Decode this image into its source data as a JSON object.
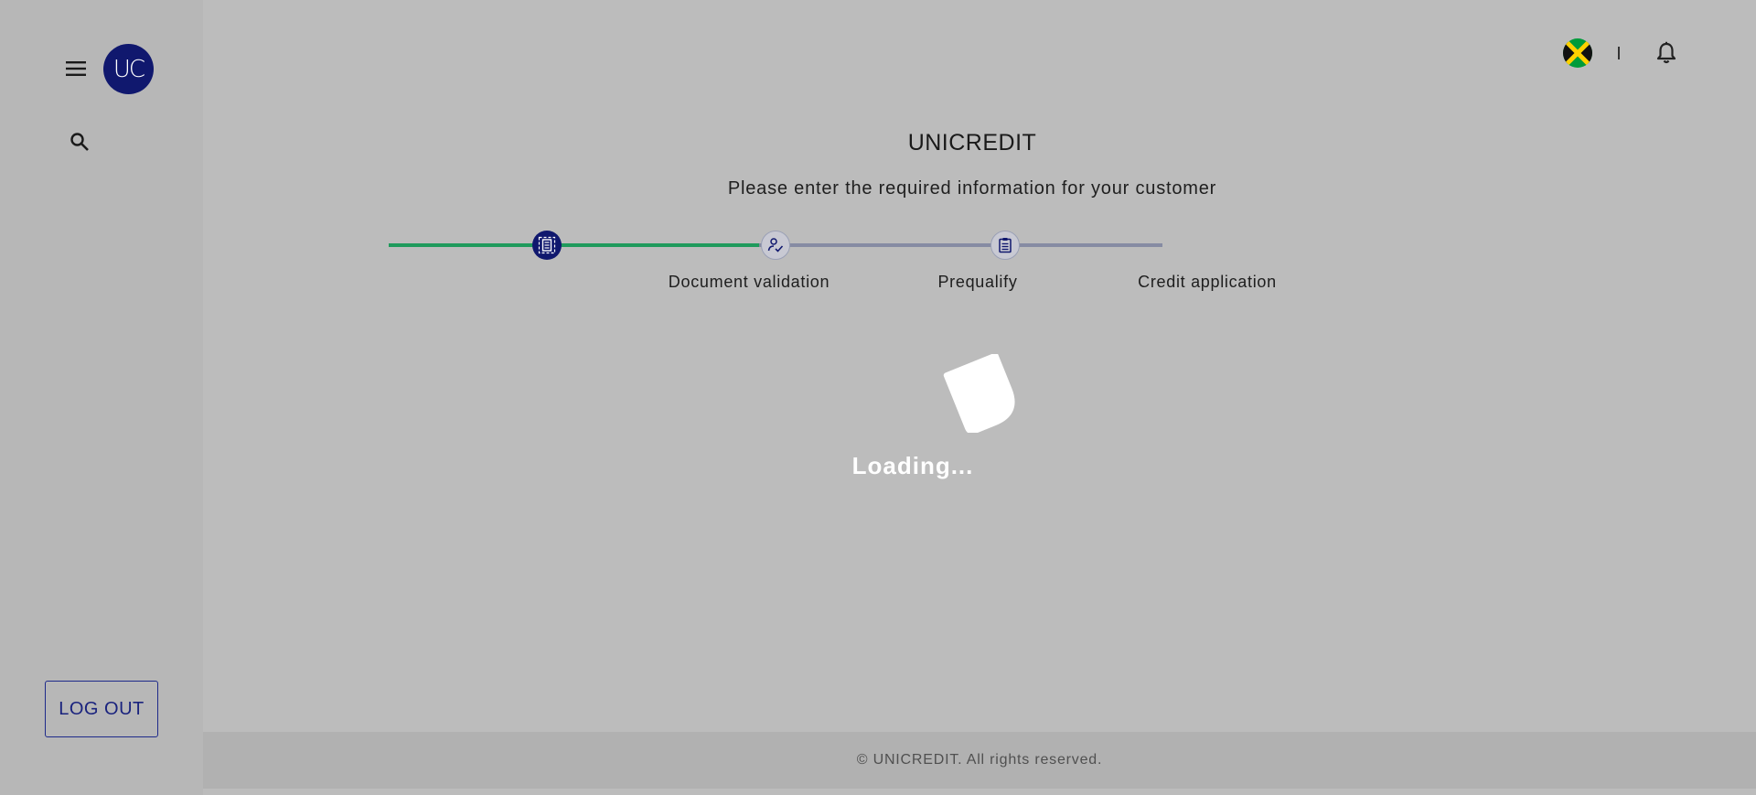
{
  "sidebar": {
    "logo_text": "UC",
    "logout_label": "LOG OUT"
  },
  "header": {
    "title": "UNICREDIT",
    "subtitle": "Please enter the required information for your customer"
  },
  "stepper": {
    "steps": [
      {
        "label": "Document validation",
        "state": "active",
        "icon": "document-icon"
      },
      {
        "label": "Prequalify",
        "state": "pending",
        "icon": "person-check-icon"
      },
      {
        "label": "Credit application",
        "state": "pending",
        "icon": "clipboard-icon"
      }
    ]
  },
  "loader": {
    "text": "Loading..."
  },
  "footer": {
    "text": "© UNICREDIT. All rights reserved."
  },
  "colors": {
    "brand": "#10186e",
    "progress_done": "#1f9a5c",
    "progress_pending": "#868ba3",
    "overlay": "#bcbcbc"
  }
}
